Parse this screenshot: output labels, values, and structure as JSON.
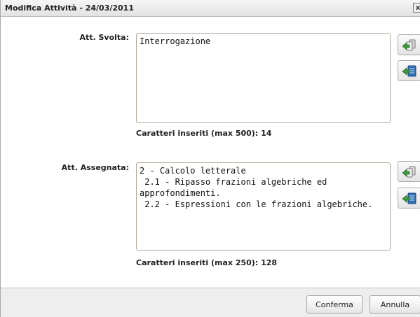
{
  "window": {
    "title": "Modifica Attività - 24/03/2011",
    "close_glyph": "x"
  },
  "svolta": {
    "label": "Att. Svolta:",
    "text": "Interrogazione",
    "counter": "Caratteri inseriti (max 500): 14",
    "icons": [
      "copy-icon",
      "insert-icon"
    ]
  },
  "assegnata": {
    "label": "Att. Assegnata:",
    "text": "2 - Calcolo letterale\n 2.1 - Ripasso frazioni algebriche ed approfondimenti.\n 2.2 - Espressioni con le frazioni algebriche.",
    "counter": "Caratteri inseriti (max 250): 128",
    "icons": [
      "copy-icon",
      "insert-icon"
    ]
  },
  "buttons": {
    "confirm": "Conferma",
    "cancel": "Annulla"
  },
  "colors": {
    "accent_green": "#3c9a3c",
    "accent_blue": "#2f6fb5"
  }
}
